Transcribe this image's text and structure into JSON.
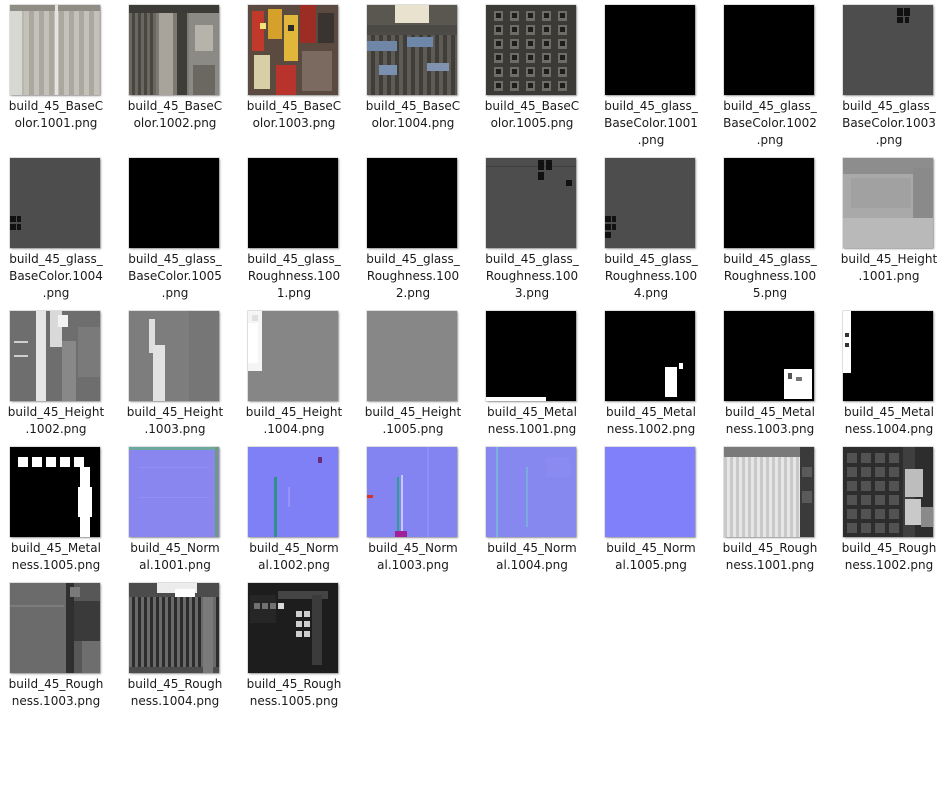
{
  "files": [
    {
      "name": "build_45_BaseColor.1001.png",
      "label_lines": [
        "build_45_BaseC",
        "olor.1001.png"
      ],
      "color": "#b9b6ae",
      "icon": "basecolor-thumbnail"
    },
    {
      "name": "build_45_BaseColor.1002.png",
      "label_lines": [
        "build_45_BaseC",
        "olor.1002.png"
      ],
      "color": "#7d7a73",
      "icon": "basecolor-thumbnail"
    },
    {
      "name": "build_45_BaseColor.1003.png",
      "label_lines": [
        "build_45_BaseC",
        "olor.1003.png"
      ],
      "color": "#8a5f3e",
      "icon": "basecolor-thumbnail"
    },
    {
      "name": "build_45_BaseColor.1004.png",
      "label_lines": [
        "build_45_BaseC",
        "olor.1004.png"
      ],
      "color": "#5a5650",
      "icon": "basecolor-thumbnail"
    },
    {
      "name": "build_45_BaseColor.1005.png",
      "label_lines": [
        "build_45_BaseC",
        "olor.1005.png"
      ],
      "color": "#3b3a36",
      "icon": "basecolor-thumbnail"
    },
    {
      "name": "build_45_glass_BaseColor.1001.png",
      "label_lines": [
        "build_45_glass_",
        "BaseColor.1001",
        ".png"
      ],
      "color": "#000000",
      "icon": "glass-basecolor-thumbnail"
    },
    {
      "name": "build_45_glass_BaseColor.1002.png",
      "label_lines": [
        "build_45_glass_",
        "BaseColor.1002",
        ".png"
      ],
      "color": "#000000",
      "icon": "glass-basecolor-thumbnail"
    },
    {
      "name": "build_45_glass_BaseColor.1003.png",
      "label_lines": [
        "build_45_glass_",
        "BaseColor.1003",
        ".png"
      ],
      "color": "#4d4d4d",
      "icon": "glass-basecolor-thumbnail"
    },
    {
      "name": "build_45_glass_BaseColor.1004.png",
      "label_lines": [
        "build_45_glass_",
        "BaseColor.1004",
        ".png"
      ],
      "color": "#4d4d4d",
      "icon": "glass-basecolor-thumbnail"
    },
    {
      "name": "build_45_glass_BaseColor.1005.png",
      "label_lines": [
        "build_45_glass_",
        "BaseColor.1005",
        ".png"
      ],
      "color": "#000000",
      "icon": "glass-basecolor-thumbnail"
    },
    {
      "name": "build_45_glass_Roughness.1001.png",
      "label_lines": [
        "build_45_glass_",
        "Roughness.100",
        "1.png"
      ],
      "color": "#000000",
      "icon": "glass-roughness-thumbnail"
    },
    {
      "name": "build_45_glass_Roughness.1002.png",
      "label_lines": [
        "build_45_glass_",
        "Roughness.100",
        "2.png"
      ],
      "color": "#000000",
      "icon": "glass-roughness-thumbnail"
    },
    {
      "name": "build_45_glass_Roughness.1003.png",
      "label_lines": [
        "build_45_glass_",
        "Roughness.100",
        "3.png"
      ],
      "color": "#4d4d4d",
      "icon": "glass-roughness-thumbnail"
    },
    {
      "name": "build_45_glass_Roughness.1004.png",
      "label_lines": [
        "build_45_glass_",
        "Roughness.100",
        "4.png"
      ],
      "color": "#4d4d4d",
      "icon": "glass-roughness-thumbnail"
    },
    {
      "name": "build_45_glass_Roughness.1005.png",
      "label_lines": [
        "build_45_glass_",
        "Roughness.100",
        "5.png"
      ],
      "color": "#000000",
      "icon": "glass-roughness-thumbnail"
    },
    {
      "name": "build_45_Height.1001.png",
      "label_lines": [
        "build_45_Height",
        ".1001.png"
      ],
      "color": "#a9a9a9",
      "icon": "height-thumbnail"
    },
    {
      "name": "build_45_Height.1002.png",
      "label_lines": [
        "build_45_Height",
        ".1002.png"
      ],
      "color": "#6e6e6e",
      "icon": "height-thumbnail"
    },
    {
      "name": "build_45_Height.1003.png",
      "label_lines": [
        "build_45_Height",
        ".1003.png"
      ],
      "color": "#7d7d7d",
      "icon": "height-thumbnail"
    },
    {
      "name": "build_45_Height.1004.png",
      "label_lines": [
        "build_45_Height",
        ".1004.png"
      ],
      "color": "#868686",
      "icon": "height-thumbnail"
    },
    {
      "name": "build_45_Height.1005.png",
      "label_lines": [
        "build_45_Height",
        ".1005.png"
      ],
      "color": "#878787",
      "icon": "height-thumbnail"
    },
    {
      "name": "build_45_Metalness.1001.png",
      "label_lines": [
        "build_45_Metal",
        "ness.1001.png"
      ],
      "color": "#000000",
      "icon": "metalness-thumbnail"
    },
    {
      "name": "build_45_Metalness.1002.png",
      "label_lines": [
        "build_45_Metal",
        "ness.1002.png"
      ],
      "color": "#000000",
      "icon": "metalness-thumbnail"
    },
    {
      "name": "build_45_Metalness.1003.png",
      "label_lines": [
        "build_45_Metal",
        "ness.1003.png"
      ],
      "color": "#000000",
      "icon": "metalness-thumbnail"
    },
    {
      "name": "build_45_Metalness.1004.png",
      "label_lines": [
        "build_45_Metal",
        "ness.1004.png"
      ],
      "color": "#000000",
      "icon": "metalness-thumbnail"
    },
    {
      "name": "build_45_Metalness.1005.png",
      "label_lines": [
        "build_45_Metal",
        "ness.1005.png"
      ],
      "color": "#000000",
      "icon": "metalness-thumbnail"
    },
    {
      "name": "build_45_Normal.1001.png",
      "label_lines": [
        "build_45_Norm",
        "al.1001.png"
      ],
      "color": "#8a86f0",
      "icon": "normal-map-thumbnail"
    },
    {
      "name": "build_45_Normal.1002.png",
      "label_lines": [
        "build_45_Norm",
        "al.1002.png"
      ],
      "color": "#7f7ff6",
      "icon": "normal-map-thumbnail"
    },
    {
      "name": "build_45_Normal.1003.png",
      "label_lines": [
        "build_45_Norm",
        "al.1003.png"
      ],
      "color": "#8383f2",
      "icon": "normal-map-thumbnail"
    },
    {
      "name": "build_45_Normal.1004.png",
      "label_lines": [
        "build_45_Norm",
        "al.1004.png"
      ],
      "color": "#8688ef",
      "icon": "normal-map-thumbnail"
    },
    {
      "name": "build_45_Normal.1005.png",
      "label_lines": [
        "build_45_Norm",
        "al.1005.png"
      ],
      "color": "#8080fb",
      "icon": "normal-map-thumbnail"
    },
    {
      "name": "build_45_Roughness.1001.png",
      "label_lines": [
        "build_45_Rough",
        "ness.1001.png"
      ],
      "color": "#d6d6d6",
      "icon": "roughness-thumbnail"
    },
    {
      "name": "build_45_Roughness.1002.png",
      "label_lines": [
        "build_45_Rough",
        "ness.1002.png"
      ],
      "color": "#2d2d2d",
      "icon": "roughness-thumbnail"
    },
    {
      "name": "build_45_Roughness.1003.png",
      "label_lines": [
        "build_45_Rough",
        "ness.1003.png"
      ],
      "color": "#575757",
      "icon": "roughness-thumbnail"
    },
    {
      "name": "build_45_Roughness.1004.png",
      "label_lines": [
        "build_45_Rough",
        "ness.1004.png"
      ],
      "color": "#4c4c4c",
      "icon": "roughness-thumbnail"
    },
    {
      "name": "build_45_Roughness.1005.png",
      "label_lines": [
        "build_45_Rough",
        "ness.1005.png"
      ],
      "color": "#1d1d1d",
      "icon": "roughness-thumbnail"
    }
  ]
}
